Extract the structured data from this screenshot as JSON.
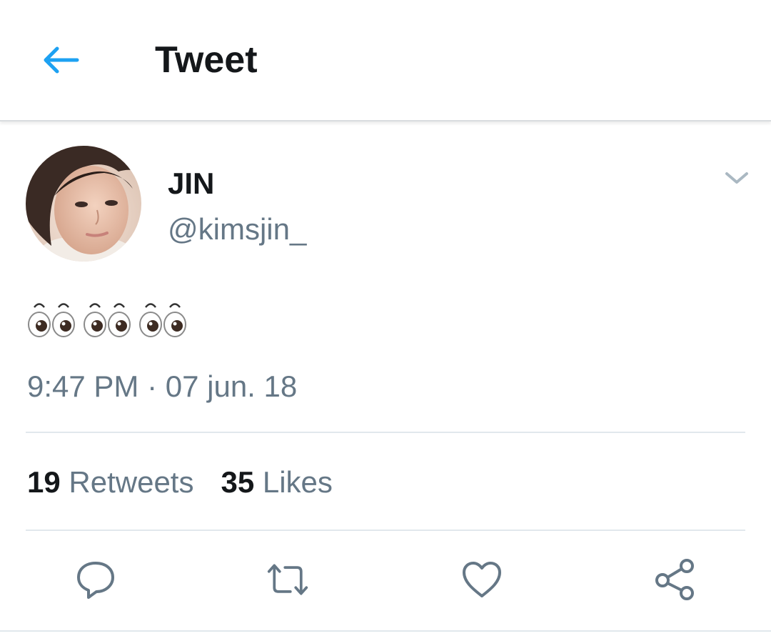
{
  "header": {
    "title": "Tweet",
    "back_icon": "arrow-left-icon",
    "accent_color": "#1da1f2"
  },
  "tweet": {
    "author": {
      "display_name": "JIN",
      "handle": "@kimsjin_"
    },
    "text": "👀👀👀",
    "timestamp": "9:47 PM · 07 jun. 18",
    "retweets": {
      "count": "19",
      "label": "Retweets"
    },
    "likes": {
      "count": "35",
      "label": "Likes"
    }
  },
  "actions": [
    "reply-icon",
    "retweet-icon",
    "like-icon",
    "share-icon"
  ]
}
